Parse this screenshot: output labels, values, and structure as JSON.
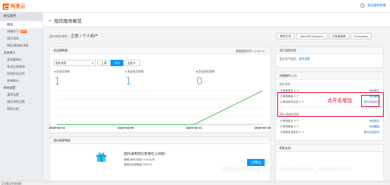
{
  "topbar": {
    "logo_text": "阿里云",
    "feedback_link": "短信服务新版"
  },
  "sidebar": {
    "header": "短信服务",
    "items": [
      {
        "label": "概览",
        "active": true,
        "type": "item"
      },
      {
        "label": "快捷学习",
        "badge": "NEW",
        "type": "item"
      },
      {
        "label": "国内消息",
        "type": "item"
      },
      {
        "label": "国际/港澳台消息",
        "type": "item"
      },
      {
        "label": "业务统计",
        "type": "group"
      },
      {
        "label": "发送量统计",
        "type": "item"
      },
      {
        "label": "发送记录查询",
        "type": "item"
      },
      {
        "label": "短链任务分析",
        "type": "item"
      },
      {
        "label": "账单统计",
        "type": "item"
      },
      {
        "label": "系统设置",
        "type": "group"
      },
      {
        "label": "通用设置",
        "type": "item"
      },
      {
        "label": "国内消息设置",
        "type": "item"
      },
      {
        "label": "帮助文档",
        "type": "item"
      }
    ]
  },
  "title_bar": {
    "back": "←",
    "title": "短信服务概览"
  },
  "crumb": {
    "prefix": "国内状态/类型：",
    "value": "正常 / 个人用户"
  },
  "tab_buttons": [
    "教学引导",
    "OpenAPI Explorer",
    "开发者指南",
    "AccessKey"
  ],
  "usage": {
    "header": "发送量数据",
    "time": "数据获取时间 14:48:10",
    "select_value": "国内消息",
    "ranges": [
      "上周",
      "本月",
      "自定义"
    ],
    "active_range": "本月",
    "stats": [
      {
        "label": "发送总条数",
        "value": "1",
        "color": "#0099ff"
      },
      {
        "label": "发送成功条数",
        "value": "1",
        "color": "#2db83d"
      },
      {
        "label": "发送失败条数",
        "value": "0",
        "color": "#e4002b"
      }
    ]
  },
  "chart_data": {
    "type": "line",
    "x": [
      "2020-04-01",
      "2020-04-06",
      "2020-04-11",
      "2020-04-16"
    ],
    "series": [
      {
        "values": [
          0,
          0,
          0,
          1
        ],
        "color": "#2db83d"
      }
    ],
    "ylim": [
      0,
      1
    ],
    "grid": true
  },
  "packages": {
    "header": "国内套餐数据",
    "title": "国内通用短信套餐包上线啦！",
    "lines": [
      "套餐包单价低至0.035元/条",
      "套餐包容量最高10000万"
    ],
    "button": "立即购买"
  },
  "monitor": {
    "header": "用户监控信息",
    "text": "暂无用户监控。",
    "link": "前往设置"
  },
  "quick": {
    "header": "快捷操作入口",
    "domestic_sub": "国内消息",
    "domestic_rows": [
      {
        "label": "已审核签名 0 个",
        "link": "添加签名"
      },
      {
        "label": "已审核模板 0 个",
        "link": "添加模板"
      },
      {
        "label": "已审核群发任务 0 个",
        "link": "提交发送任务"
      }
    ],
    "intl_sub": "国际/港澳台消息",
    "intl_rows": [
      {
        "label": "已审核签名 0 个",
        "link": "添加签名"
      },
      {
        "label": "已审核模板 0 个",
        "link": "添加模板"
      },
      {
        "label": "已审核发送任务 0 个",
        "link": "提交发送任务"
      }
    ]
  },
  "help": {
    "header": "帮助文档"
  },
  "annotation": {
    "text": "点开去增加"
  },
  "watermark": "https://blog.csdn.net/weixin_44944193",
  "status_bar": "正在建立安全连接..."
}
